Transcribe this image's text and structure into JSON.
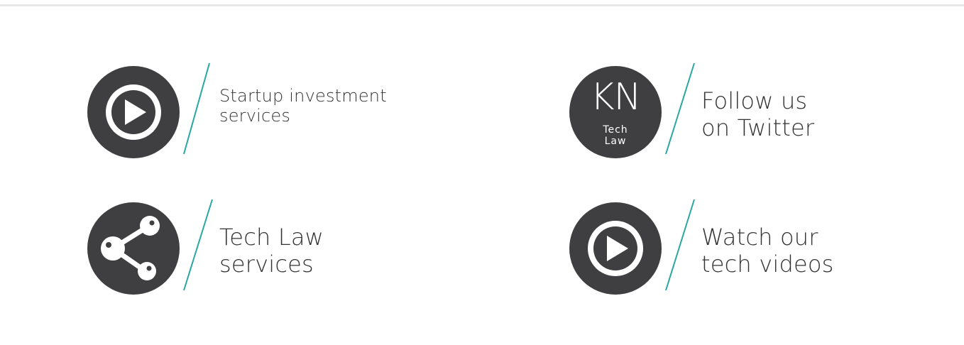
{
  "tiles": [
    {
      "id": "startup",
      "icon": "play-icon",
      "lines": [
        "Startup investment",
        "services"
      ]
    },
    {
      "id": "twitter",
      "icon": "kn-tech-law-logo",
      "logo": {
        "initials": "KN",
        "line1": "Tech",
        "line2": "Law"
      },
      "lines": [
        "Follow us",
        "on Twitter"
      ]
    },
    {
      "id": "techlaw",
      "icon": "share-icon",
      "lines": [
        "Tech Law",
        "services"
      ]
    },
    {
      "id": "videos",
      "icon": "play-icon",
      "lines": [
        "Watch our",
        "tech videos"
      ]
    }
  ],
  "colors": {
    "icon_bg": "#3f3f41",
    "accent_slash": "#2aa6a3",
    "text": "#333333",
    "top_rule": "#e8e8e8"
  }
}
